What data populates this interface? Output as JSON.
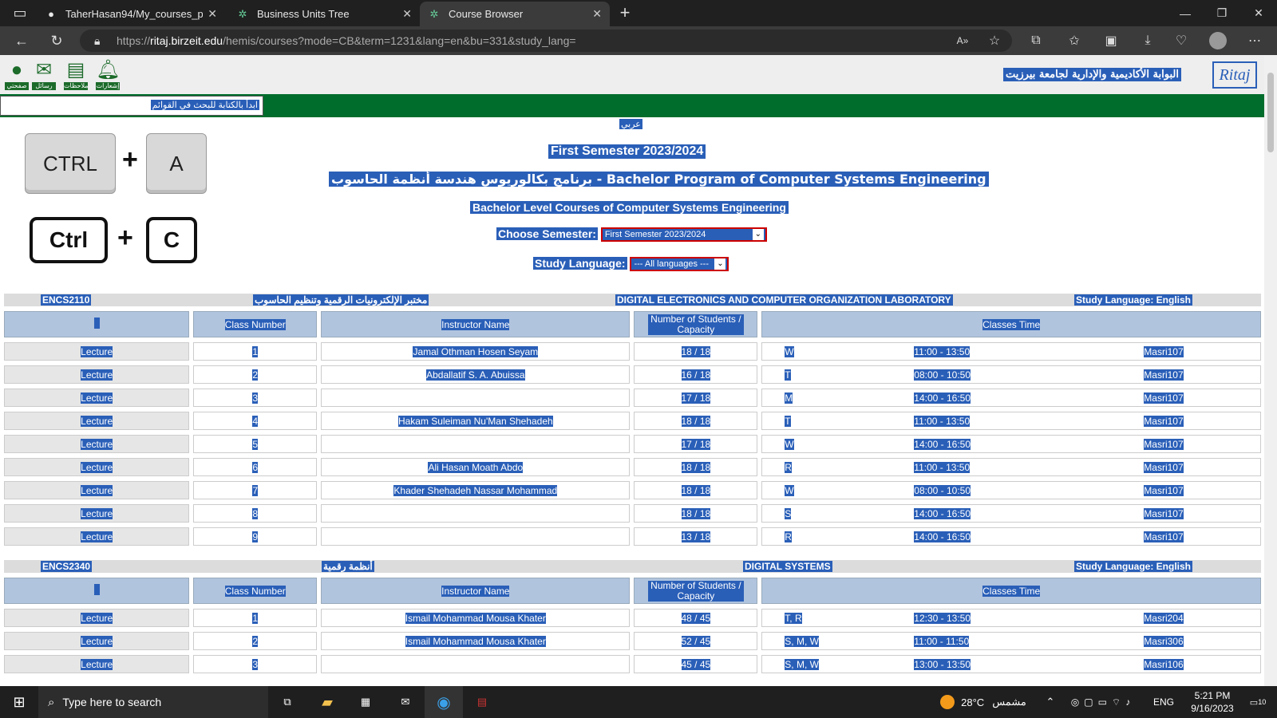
{
  "browser": {
    "tabs": [
      {
        "title": "TaherHasan94/My_courses_proje",
        "icon": "github-icon"
      },
      {
        "title": "Business Units Tree",
        "icon": "birzeit-icon"
      },
      {
        "title": "Course Browser",
        "icon": "birzeit-icon"
      }
    ],
    "url_prefix": "https://",
    "url_host": "ritaj.birzeit.edu",
    "url_path": "/hemis/courses?mode=CB&term=1231&lang=en&bu=331&study_lang="
  },
  "header": {
    "icons": [
      {
        "label": "صفحتي",
        "icon": "person-icon"
      },
      {
        "label": "رسائل",
        "icon": "mail-icon"
      },
      {
        "label": "ملاحظات",
        "icon": "news-icon"
      },
      {
        "label": "إشعارات",
        "icon": "bell-icon"
      }
    ],
    "brand_text": "البوابة الأكاديمية والإدارية لجامعة بيرزيت",
    "brand_logo": "Ritaj"
  },
  "search": {
    "placeholder": "ابدأ بالكتابة للبحث في القوائم"
  },
  "lang_link": "عربي",
  "semester_title": "First Semester 2023/2024",
  "program_title": "برنامج بكالوريوس هندسة أنظمة الحاسوب - Bachelor Program of Computer Systems Engineering",
  "level_title": "Bachelor Level Courses of Computer Systems Engineering",
  "choose_semester": {
    "label": "Choose Semester:",
    "value": "First Semester 2023/2024"
  },
  "study_language": {
    "label": "Study Language:",
    "value": "--- All languages ---"
  },
  "keys": {
    "ctrl_a": [
      "CTRL",
      "A"
    ],
    "ctrl_c": [
      "Ctrl",
      "C"
    ],
    "plus": "+"
  },
  "table_headers": {
    "blank": "",
    "class_number": "Class Number",
    "instructor": "Instructor Name",
    "students": "Number of Students / Capacity",
    "time": "Classes Time"
  },
  "courses": [
    {
      "code": "ENCS2110",
      "arabic": "مختبر الإلكترونيات الرقمية وتنظيم الحاسوب",
      "english": "DIGITAL ELECTRONICS AND COMPUTER ORGANIZATION LABORATORY",
      "language": "Study Language: English",
      "sections": [
        {
          "type": "Lecture",
          "num": "1",
          "instructor": "Jamal Othman Hosen Seyam",
          "students": "18 / 18",
          "days": "W",
          "time": "11:00 - 13:50",
          "room": "Masri107"
        },
        {
          "type": "Lecture",
          "num": "2",
          "instructor": "Abdallatif S. A. Abuissa",
          "students": "16 / 18",
          "days": "T",
          "time": "08:00 - 10:50",
          "room": "Masri107"
        },
        {
          "type": "Lecture",
          "num": "3",
          "instructor": "",
          "students": "17 / 18",
          "days": "M",
          "time": "14:00 - 16:50",
          "room": "Masri107"
        },
        {
          "type": "Lecture",
          "num": "4",
          "instructor": "Hakam Suleiman Nu'Man Shehadeh",
          "students": "18 / 18",
          "days": "T",
          "time": "11:00 - 13:50",
          "room": "Masri107"
        },
        {
          "type": "Lecture",
          "num": "5",
          "instructor": "",
          "students": "17 / 18",
          "days": "W",
          "time": "14:00 - 16:50",
          "room": "Masri107"
        },
        {
          "type": "Lecture",
          "num": "6",
          "instructor": "Ali Hasan Moath Abdo",
          "students": "18 / 18",
          "days": "R",
          "time": "11:00 - 13:50",
          "room": "Masri107"
        },
        {
          "type": "Lecture",
          "num": "7",
          "instructor": "Khader Shehadeh Nassar Mohammad",
          "students": "18 / 18",
          "days": "W",
          "time": "08:00 - 10:50",
          "room": "Masri107"
        },
        {
          "type": "Lecture",
          "num": "8",
          "instructor": "",
          "students": "18 / 18",
          "days": "S",
          "time": "14:00 - 16:50",
          "room": "Masri107"
        },
        {
          "type": "Lecture",
          "num": "9",
          "instructor": "",
          "students": "13 / 18",
          "days": "R",
          "time": "14:00 - 16:50",
          "room": "Masri107"
        }
      ]
    },
    {
      "code": "ENCS2340",
      "arabic": "أنظمة رقمية",
      "english": "DIGITAL SYSTEMS",
      "language": "Study Language: English",
      "sections": [
        {
          "type": "Lecture",
          "num": "1",
          "instructor": "Ismail Mohammad Mousa Khater",
          "students": "48 / 45",
          "days": "T, R",
          "time": "12:30 - 13:50",
          "room": "Masri204"
        },
        {
          "type": "Lecture",
          "num": "2",
          "instructor": "Ismail Mohammad Mousa Khater",
          "students": "52 / 45",
          "days": "S, M, W",
          "time": "11:00 - 11:50",
          "room": "Masri306"
        },
        {
          "type": "Lecture",
          "num": "3",
          "instructor": "",
          "students": "45 / 45",
          "days": "S, M, W",
          "time": "13:00 - 13:50",
          "room": "Masri106"
        }
      ]
    }
  ],
  "taskbar": {
    "search_placeholder": "Type here to search",
    "weather": "28°C",
    "weather_text": "مشمس",
    "lang": "ENG",
    "time": "5:21 PM",
    "date": "9/16/2023",
    "notifications": "10"
  }
}
